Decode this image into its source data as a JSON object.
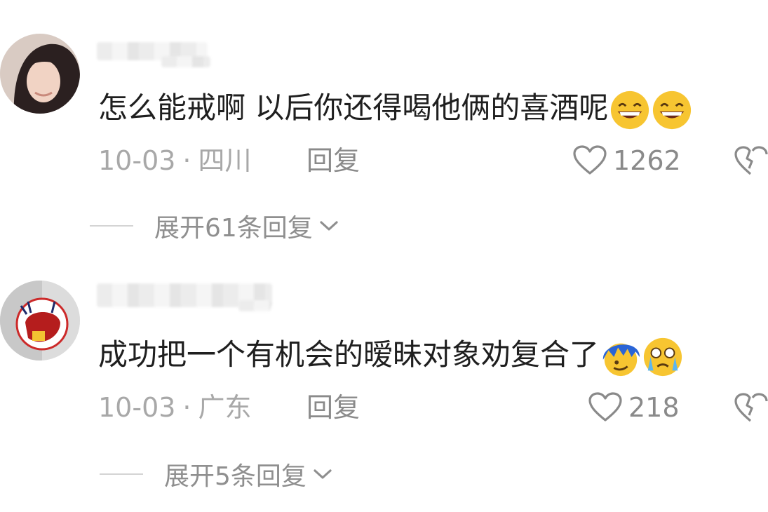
{
  "comments": [
    {
      "text": "怎么能戒啊 以后你还得喝他俩的喜酒呢",
      "emojis": [
        "grinning-face-emoji",
        "grinning-face-emoji"
      ],
      "date": "10-03",
      "separator": "·",
      "location": "四川",
      "reply_label": "回复",
      "likes": "1262",
      "expand_label": "展开61条回复"
    },
    {
      "text": "成功把一个有机会的暧昧对象劝复合了",
      "emojis": [
        "blue-hair-face-emoji",
        "crying-face-emoji"
      ],
      "date": "10-03",
      "separator": "·",
      "location": "广东",
      "reply_label": "回复",
      "likes": "218",
      "expand_label": "展开5条回复"
    }
  ],
  "colors": {
    "text": "#1f1f1f",
    "meta": "#a8a8a8",
    "action": "#8a8a8a",
    "divider": "#d4d4d4"
  }
}
